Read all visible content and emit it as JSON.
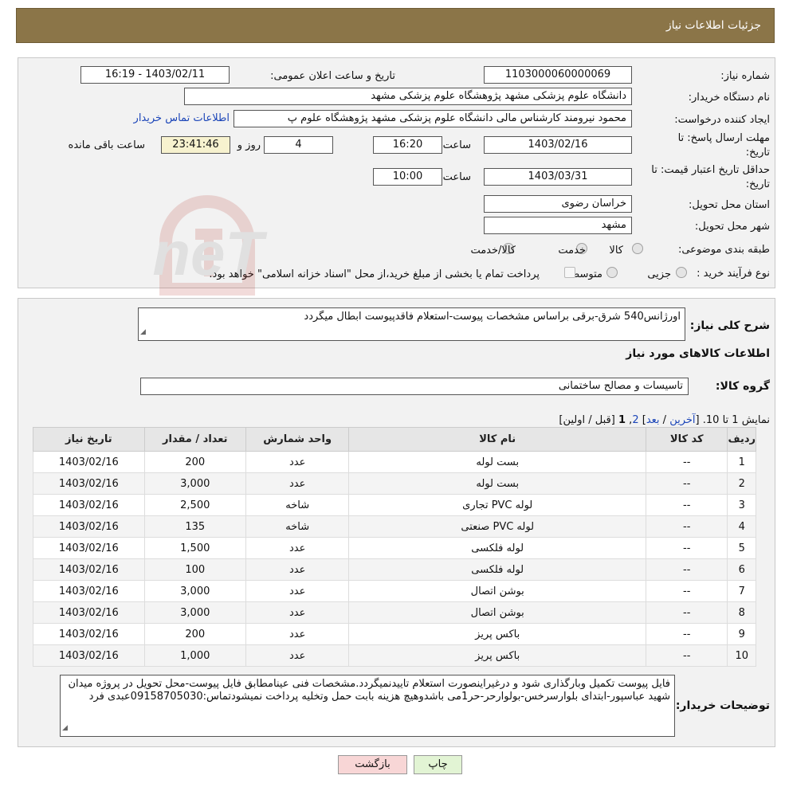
{
  "header": {
    "title": "جزئیات اطلاعات نیاز"
  },
  "details": {
    "need_number_label": "شماره نیاز:",
    "need_number": "1103000060000069",
    "announce_label": "تاریخ و ساعت اعلان عمومی:",
    "announce_value": "1403/02/11 - 16:19",
    "buyer_org_label": "نام دستگاه خریدار:",
    "buyer_org": "دانشگاه علوم پزشکی مشهد   پژوهشگاه علوم پزشکی مشهد",
    "creator_label": "ایجاد کننده درخواست:",
    "creator": "محمود نیرومند کارشناس مالی دانشگاه علوم پزشکی مشهد   پژوهشگاه علوم پ",
    "contact_link": "اطلاعات تماس خریدار",
    "deadline_label": "مهلت ارسال پاسخ: تا",
    "deadline_label2": "تاریخ:",
    "deadline_date": "1403/02/16",
    "time_label": "ساعت",
    "deadline_time": "16:20",
    "days_value": "4",
    "days_label": "روز و",
    "remaining_value": "23:41:46",
    "remaining_label": "ساعت باقی مانده",
    "validity_label": "حداقل تاریخ اعتبار قیمت: تا",
    "validity_label2": "تاریخ:",
    "validity_date": "1403/03/31",
    "validity_time": "10:00",
    "province_label": "استان محل تحویل:",
    "province": "خراسان رضوی",
    "city_label": "شهر محل تحویل:",
    "city": "مشهد",
    "category_label": "طبقه بندی موضوعی:",
    "category_options": [
      "کالا",
      "خدمت",
      "کالا/خدمت"
    ],
    "process_label": "نوع فرآیند خرید :",
    "process_options": [
      "جزیی",
      "متوسط"
    ],
    "process_note": "پرداخت تمام یا بخشی از مبلغ خرید،از محل \"اسناد خزانه اسلامی\" خواهد بود."
  },
  "summary": {
    "desc_label": "شرح کلی نیاز:",
    "desc_value": "اورژانس540 شرق-برقی براساس مشخصات پیوست-استعلام فاقدپیوست ابطال میگردد",
    "goods_info_title": "اطلاعات کالاهای مورد نیاز",
    "group_label": "گروه کالا:",
    "group_value": "تاسیسات و مصالح ساختمانی",
    "paging_prefix": "نمایش 1 تا 10.",
    "paging_open": "[",
    "paging_last": "آخرین",
    "paging_sep1": "/",
    "paging_next": "بعد",
    "paging_close": "]",
    "paging_page2": "2",
    "paging_comma": ",",
    "paging_page1": "1",
    "paging_tail": "[قبل / اولین]",
    "buyer_notes_label": "توضیحات خریدار:",
    "buyer_notes": "فایل پیوست تکمیل وبارگذاری شود و درغیراینصورت استعلام تاییدنمیگردد.مشخصات فنی عینامطابق فایل پیوست-محل تحویل در پروژه میدان شهید عباسپور-ابتدای بلوارسرخس-بولوارحر-حر1می باشدوهیچ هزینه بابت حمل وتخلیه پرداخت نمیشودتماس:09158705030عبدی فرد"
  },
  "table": {
    "headers": [
      "ردیف",
      "کد کالا",
      "نام کالا",
      "واحد شمارش",
      "تعداد / مقدار",
      "تاریخ نیاز"
    ],
    "rows": [
      [
        "1",
        "--",
        "بست لوله",
        "عدد",
        "200",
        "1403/02/16"
      ],
      [
        "2",
        "--",
        "بست لوله",
        "عدد",
        "3,000",
        "1403/02/16"
      ],
      [
        "3",
        "--",
        "لوله PVC تجاری",
        "شاخه",
        "2,500",
        "1403/02/16"
      ],
      [
        "4",
        "--",
        "لوله PVC صنعتی",
        "شاخه",
        "135",
        "1403/02/16"
      ],
      [
        "5",
        "--",
        "لوله فلکسی",
        "عدد",
        "1,500",
        "1403/02/16"
      ],
      [
        "6",
        "--",
        "لوله فلکسی",
        "عدد",
        "100",
        "1403/02/16"
      ],
      [
        "7",
        "--",
        "بوشن اتصال",
        "عدد",
        "3,000",
        "1403/02/16"
      ],
      [
        "8",
        "--",
        "بوشن اتصال",
        "عدد",
        "3,000",
        "1403/02/16"
      ],
      [
        "9",
        "--",
        "باکس پریز",
        "عدد",
        "200",
        "1403/02/16"
      ],
      [
        "10",
        "--",
        "باکس پریز",
        "عدد",
        "1,000",
        "1403/02/16"
      ]
    ]
  },
  "buttons": {
    "print": "چاپ",
    "back": "بازگشت"
  },
  "watermark": {
    "text": "AriaTender.neT"
  },
  "colors": {
    "header_bg": "#8b7548",
    "link": "#1b45b8",
    "yellow_field": "#f7f2cf",
    "back_btn": "#f8d6d6",
    "print_btn": "#e2f4d4"
  }
}
